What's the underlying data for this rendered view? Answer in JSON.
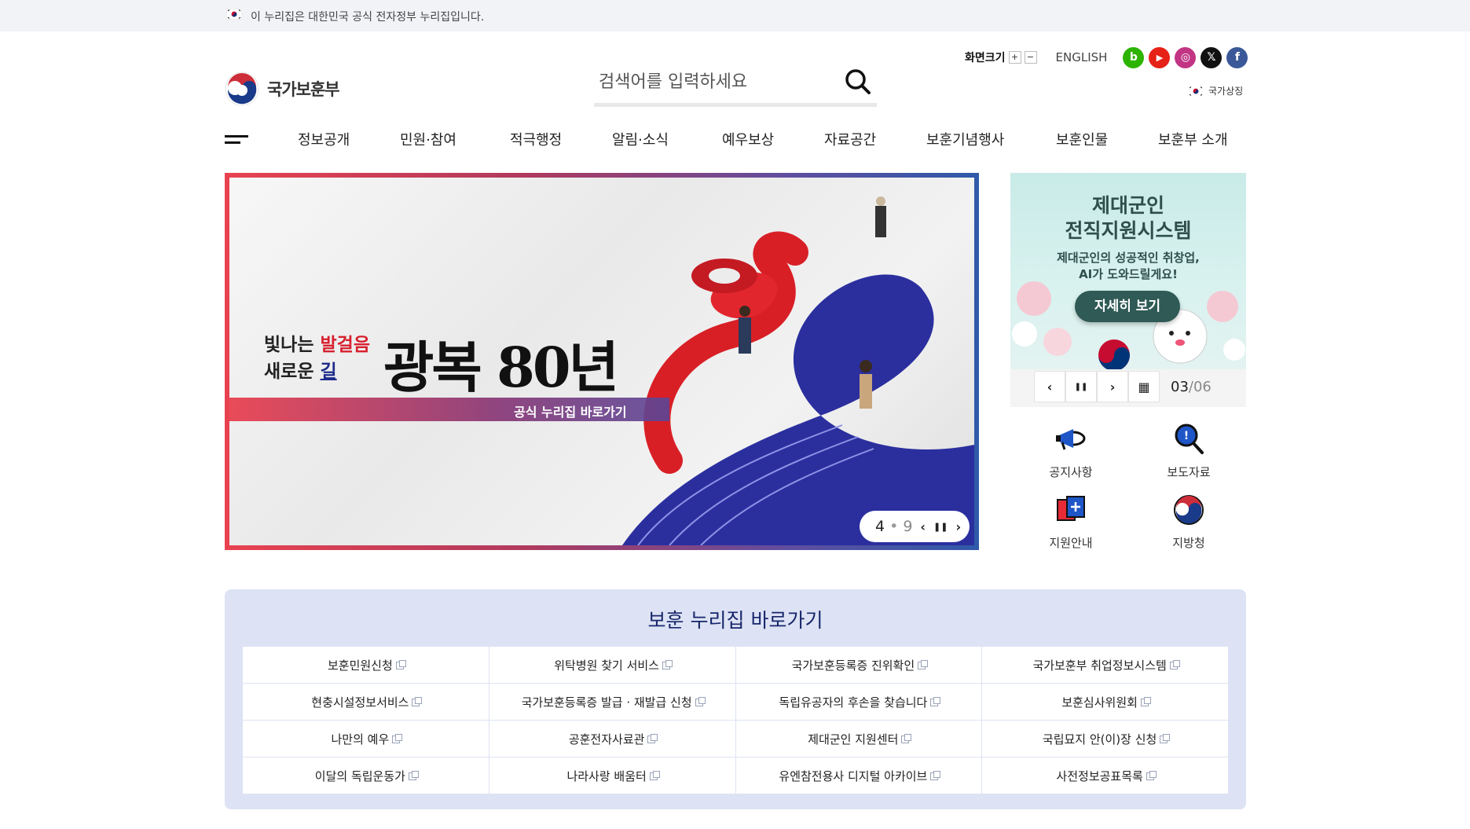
{
  "gov_bar": {
    "text": "이 누리집은 대한민국 공식 전자정부 누리집입니다."
  },
  "logo": {
    "name": "국가보훈부"
  },
  "search": {
    "placeholder": "검색어를 입력하세요"
  },
  "util": {
    "zoom_label": "화면크기",
    "zoom_in": "+",
    "zoom_out": "−",
    "english": "ENGLISH",
    "national_symbol": "국가상징"
  },
  "social": [
    {
      "name": "blog",
      "glyph": "b",
      "color": "#2db400"
    },
    {
      "name": "youtube",
      "glyph": "▶",
      "color": "#e62117"
    },
    {
      "name": "instagram",
      "glyph": "◎",
      "color": "#c13584"
    },
    {
      "name": "x",
      "glyph": "𝕏",
      "color": "#111111"
    },
    {
      "name": "facebook",
      "glyph": "f",
      "color": "#3b5998"
    }
  ],
  "nav": {
    "items": [
      "정보공개",
      "민원·참여",
      "적극행정",
      "알림·소식",
      "예우보상",
      "자료공간",
      "보훈기념행사",
      "보훈인물",
      "보훈부 소개"
    ]
  },
  "banner": {
    "sub_line1_a": "빛나는 ",
    "sub_line1_b": "발걸음",
    "sub_line2_a": "새로운 ",
    "sub_line2_b": "길",
    "title": "광복 80년",
    "strip": "공식 누리집 바로가기",
    "current": "4",
    "sep": "•",
    "total": "9",
    "prev": "‹",
    "pause": "❚❚",
    "next": "›"
  },
  "side_banner": {
    "title_line1": "제대군인",
    "title_line2": "전직지원시스템",
    "desc_line1": "제대군인의 성공적인 취창업,",
    "desc_line2": "AI가 도와드릴게요!",
    "cta": "자세히 보기",
    "prev": "‹",
    "pause": "❚❚",
    "next": "›",
    "all": "▦",
    "current": "03",
    "total": "/06"
  },
  "quick": [
    {
      "label": "공지사항",
      "icon": "megaphone-icon"
    },
    {
      "label": "보도자료",
      "icon": "magnifier-icon"
    },
    {
      "label": "지원안내",
      "icon": "support-icon"
    },
    {
      "label": "지방청",
      "icon": "taegeuk-icon"
    }
  ],
  "links": {
    "title": "보훈 누리집 바로가기",
    "rows": [
      [
        "보훈민원신청",
        "위탁병원 찾기 서비스",
        "국가보훈등록증 진위확인",
        "국가보훈부 취업정보시스템"
      ],
      [
        "현충시설정보서비스",
        "국가보훈등록증 발급 · 재발급 신청",
        "독립유공자의 후손을 찾습니다",
        "보훈심사위원회"
      ],
      [
        "나만의 예우",
        "공훈전자사료관",
        "제대군인 지원센터",
        "국립묘지 안(이)장 신청"
      ],
      [
        "이달의 독립운동가",
        "나라사랑 배움터",
        "유엔참전용사 디지털 아카이브",
        "사전정보공표목록"
      ]
    ]
  },
  "colors": {
    "accent": "#17266b",
    "red": "#d7202e",
    "links_bg": "#dde3f4"
  }
}
